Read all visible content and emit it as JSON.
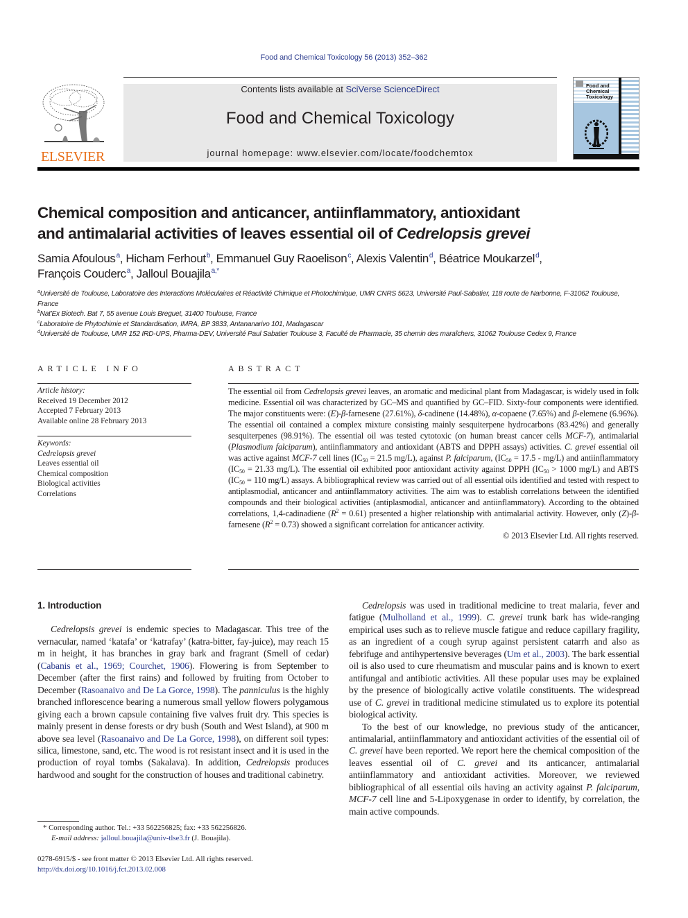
{
  "running_head": "Food and Chemical Toxicology 56 (2013) 352–362",
  "masthead": {
    "publisher_logo_text": "ELSEVIER",
    "contents_prefix": "Contents lists available at ",
    "contents_link": "SciVerse ScienceDirect",
    "journal_title": "Food and Chemical Toxicology",
    "homepage": "journal homepage: www.elsevier.com/locate/foodchemtox",
    "cover_title_lines": [
      "Food and",
      "Chemical",
      "Toxicology"
    ]
  },
  "article": {
    "title_line1": "Chemical composition and anticancer, antiinflammatory, antioxidant",
    "title_line2_prefix": "and antimalarial activities of leaves essential oil of ",
    "title_line2_species": "Cedrelopsis grevei",
    "authors": [
      {
        "name": "Samia Afoulous",
        "aff": "a"
      },
      {
        "name": "Hicham Ferhout",
        "aff": "b"
      },
      {
        "name": "Emmanuel Guy Raoelison",
        "aff": "c"
      },
      {
        "name": "Alexis Valentin",
        "aff": "d"
      },
      {
        "name": "Béatrice Moukarzel",
        "aff": "d"
      },
      {
        "name": "François Couderc",
        "aff": "a"
      },
      {
        "name": "Jalloul Bouajila",
        "aff": "a,*"
      }
    ],
    "affiliations": [
      {
        "key": "a",
        "text": "Université de Toulouse, Laboratoire des Interactions Moléculaires et Réactivité Chimique et Photochimique, UMR CNRS 5623, Université Paul-Sabatier, 118 route de Narbonne, F-31062 Toulouse, France"
      },
      {
        "key": "b",
        "text": "Nat'Ex Biotech. Bat 7, 55 avenue Louis Breguet, 31400 Toulouse, France"
      },
      {
        "key": "c",
        "text": "Laboratoire de Phytochimie et Standardisation, IMRA, BP 3833, Antananarivo 101, Madagascar"
      },
      {
        "key": "d",
        "text": "Université de Toulouse, UMR 152 IRD-UPS, Pharma-DEV, Université Paul Sabatier Toulouse 3, Faculté de Pharmacie, 35 chemin des maraîchers, 31062 Toulouse Cedex 9, France"
      }
    ]
  },
  "article_info": {
    "heading": "ARTICLE INFO",
    "history_label": "Article history:",
    "history": [
      "Received 19 December 2012",
      "Accepted 7 February 2013",
      "Available online 28 February 2013"
    ],
    "keywords_label": "Keywords:",
    "keywords": [
      "Cedrelopsis grevei",
      "Leaves essential oil",
      "Chemical composition",
      "Biological activities",
      "Correlations"
    ]
  },
  "abstract": {
    "heading": "ABSTRACT",
    "copyright": "© 2013 Elsevier Ltd. All rights reserved."
  },
  "introduction": {
    "heading": "1. Introduction"
  },
  "citations": {
    "cabanis": "Cabanis et al., 1969; Courchet, 1906",
    "rasoanaivo_a": "Rasoanaivo and De La Gorce,",
    "rasoanaivo_b": "1998",
    "rasoanaivo_full": "Rasoanaivo and De La Gorce, 1998",
    "mulholland": "Mulholland et al., 1999",
    "um": "Um et al., 2003"
  },
  "footnotes": {
    "corresponding": "* Corresponding author. Tel.: +33 562256825; fax: +33 562256826.",
    "email_label": "E-mail address:",
    "email": "jalloul.bouajila@univ-tlse3.fr",
    "email_suffix": " (J. Bouajila).",
    "issn": "0278-6915/$ - see front matter © 2013 Elsevier Ltd. All rights reserved.",
    "doi": "http://dx.doi.org/10.1016/j.fct.2013.02.008"
  },
  "colors": {
    "link": "#2a3a8c",
    "elsevier_orange": "#e9711c",
    "masthead_gray": "#e8e8e8",
    "cover_blue": "#a7c6e0"
  }
}
